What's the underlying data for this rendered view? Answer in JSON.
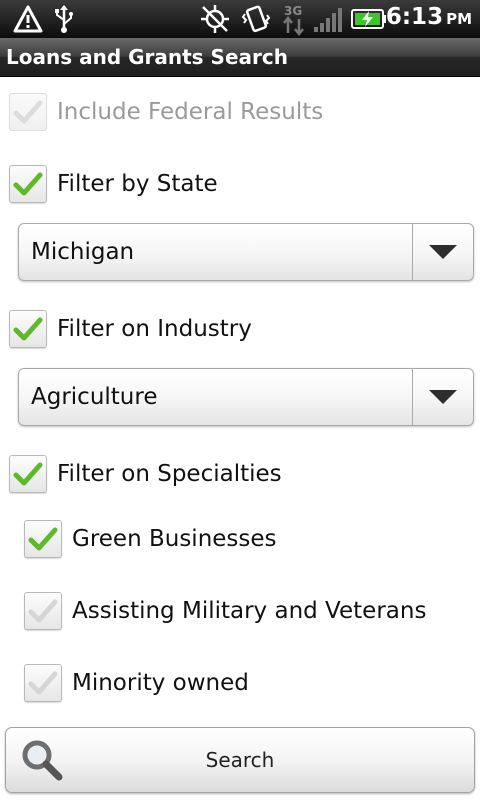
{
  "status_bar": {
    "time": "6:13",
    "ampm": "PM",
    "network": "3G",
    "icons": [
      "warning-icon",
      "usb-icon",
      "gps-off-icon",
      "vibrate-icon",
      "network-3g-icon",
      "signal-icon",
      "battery-charging-icon"
    ]
  },
  "title_bar": {
    "title": "Loans and Grants Search"
  },
  "filters": {
    "federal": {
      "label": "Include Federal Results",
      "checked": true,
      "enabled": false
    },
    "state": {
      "label": "Filter by State",
      "checked": true,
      "selected": "Michigan"
    },
    "industry": {
      "label": "Filter on Industry",
      "checked": true,
      "selected": "Agriculture"
    },
    "specialties": {
      "label": "Filter on Specialties",
      "checked": true,
      "items": [
        {
          "label": "Green Businesses",
          "checked": true
        },
        {
          "label": "Assisting Military and Veterans",
          "checked": false
        },
        {
          "label": "Minority owned",
          "checked": false
        }
      ]
    }
  },
  "search_button": {
    "label": "Search"
  },
  "colors": {
    "check_green": "#5fb82d",
    "check_grey": "#d5d5d5",
    "title_bar_bg": "#2a2a2a",
    "status_bar_bg": "#111111"
  }
}
